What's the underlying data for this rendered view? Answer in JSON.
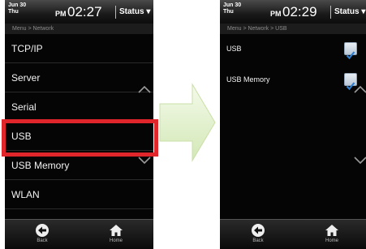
{
  "left_screen": {
    "date_line1": "Jun 30",
    "date_line2": "Thu",
    "ampm": "PM",
    "time": "02:27",
    "status_label": "Status",
    "breadcrumb": "Menu > Network",
    "items": [
      {
        "label": "TCP/IP"
      },
      {
        "label": "Server"
      },
      {
        "label": "Serial"
      },
      {
        "label": "USB"
      },
      {
        "label": "USB Memory"
      },
      {
        "label": "WLAN"
      }
    ],
    "nav": {
      "back": "Back",
      "home": "Home"
    }
  },
  "right_screen": {
    "date_line1": "Jun 30",
    "date_line2": "Thu",
    "ampm": "PM",
    "time": "02:29",
    "status_label": "Status",
    "breadcrumb": "Menu > Network > USB",
    "items": [
      {
        "label": "USB",
        "checked": true
      },
      {
        "label": "USB Memory",
        "checked": true
      }
    ],
    "nav": {
      "back": "Back",
      "home": "Home"
    }
  },
  "colors": {
    "highlight": "#e0252b",
    "arrow_fill": "#dff0c8"
  }
}
